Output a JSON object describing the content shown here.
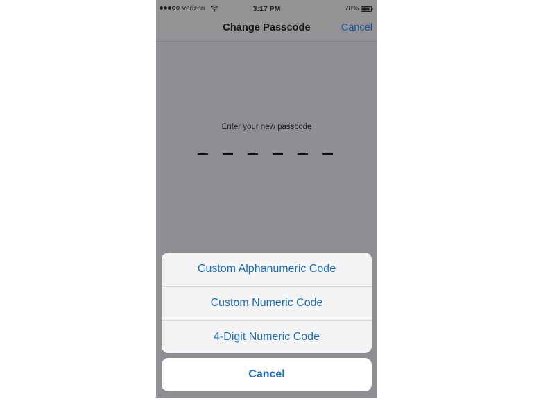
{
  "status_bar": {
    "carrier": "Verizon",
    "time": "3:17 PM",
    "battery_percent": "78%",
    "battery_level": 0.78,
    "signal_bars_filled": 3,
    "signal_bars_total": 5,
    "icons": [
      "signal-icon",
      "wifi-icon",
      "battery-icon"
    ]
  },
  "nav": {
    "title": "Change Passcode",
    "cancel_label": "Cancel"
  },
  "passcode": {
    "prompt": "Enter your new passcode",
    "digit_slots": 6
  },
  "action_sheet": {
    "options": [
      {
        "label": "Custom Alphanumeric Code"
      },
      {
        "label": "Custom Numeric Code"
      },
      {
        "label": "4-Digit Numeric Code"
      }
    ],
    "cancel_label": "Cancel"
  },
  "colors": {
    "accent": "#1a6fc4",
    "dimmed_background": "#8e8e93",
    "sheet_background": "#f4f4f5"
  }
}
